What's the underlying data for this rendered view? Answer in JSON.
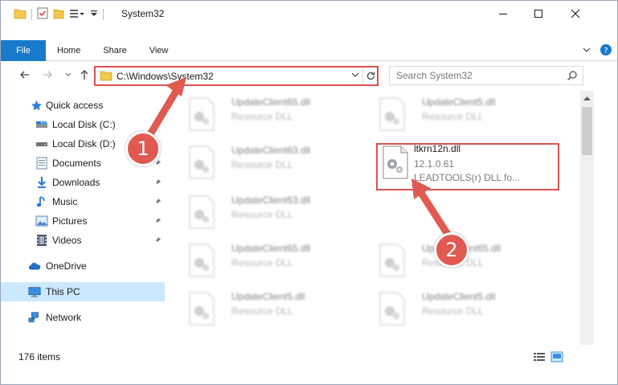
{
  "window": {
    "title": "System32",
    "controls": {
      "minimize": "—",
      "maximize": "☐",
      "close": "✕"
    }
  },
  "ribbon": {
    "tabs": [
      {
        "label": "File"
      },
      {
        "label": "Home"
      },
      {
        "label": "Share"
      },
      {
        "label": "View"
      }
    ]
  },
  "navigation": {
    "address_path": "C:\\Windows\\System32",
    "search_placeholder": "Search System32"
  },
  "sidebar": {
    "items": [
      {
        "label": "Quick access",
        "icon": "star-icon"
      },
      {
        "label": "Local Disk (C:)",
        "icon": "drive-icon"
      },
      {
        "label": "Local Disk (D:)",
        "icon": "drive-icon"
      },
      {
        "label": "Documents",
        "icon": "documents-icon"
      },
      {
        "label": "Downloads",
        "icon": "downloads-icon"
      },
      {
        "label": "Music",
        "icon": "music-icon"
      },
      {
        "label": "Pictures",
        "icon": "pictures-icon"
      },
      {
        "label": "Videos",
        "icon": "videos-icon"
      },
      {
        "label": "OneDrive",
        "icon": "cloud-icon"
      },
      {
        "label": "This PC",
        "icon": "computer-icon"
      },
      {
        "label": "Network",
        "icon": "network-icon"
      }
    ]
  },
  "files": [
    {
      "name": "UpdateClient65.dll",
      "type": "Resource DLL"
    },
    {
      "name": "UpdateClient5.dll",
      "type": "Resource DLL"
    },
    {
      "name": "UpdateClient63.dll",
      "type": "Resource DLL"
    },
    {
      "name": "ltkrn12n.dll",
      "version": "12.1.0.61",
      "description": "LEADTOOLS(r) DLL fo..."
    },
    {
      "name": "UpdateClient63.dll",
      "type": "Resource DLL"
    },
    {
      "name": "UpdateClient65.dll",
      "type": "Resource DLL"
    },
    {
      "name": "UpdateClient65.dll",
      "type": "Resource DLL"
    },
    {
      "name": "UpdateClient5.dll",
      "type": "Resource DLL"
    },
    {
      "name": "UpdateClient5.dll",
      "type": "Resource DLL"
    }
  ],
  "status": {
    "item_count": "176 items"
  },
  "annotations": {
    "step1": "1",
    "step2": "2",
    "color": "#e05a52"
  },
  "colors": {
    "accent": "#1979ca",
    "highlight_border": "#d9534f",
    "selected_bg": "#cce8ff"
  }
}
